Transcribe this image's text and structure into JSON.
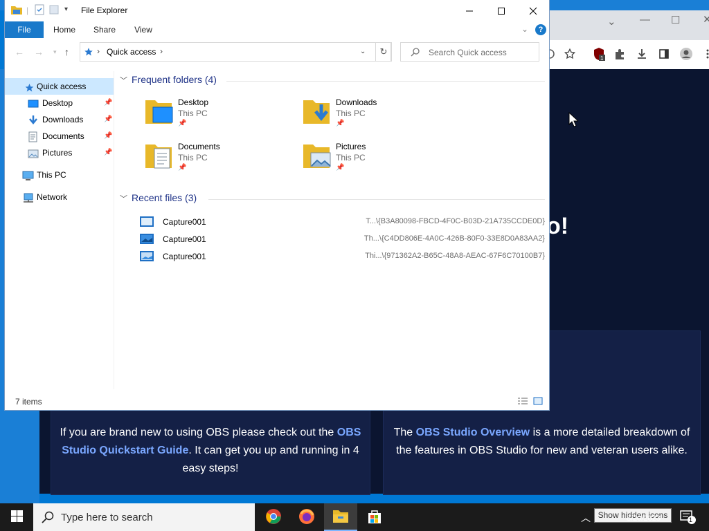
{
  "explorer": {
    "title": "File Explorer",
    "ribbon_tabs": [
      "File",
      "Home",
      "Share",
      "View"
    ],
    "help_label": "?",
    "address": "Quick access",
    "search_placeholder": "Search Quick access",
    "nav": [
      {
        "label": "Quick access",
        "icon": "star-icon",
        "selected": true
      },
      {
        "label": "Desktop",
        "icon": "desktop-icon",
        "pinned": true
      },
      {
        "label": "Downloads",
        "icon": "download-arrow-icon",
        "pinned": true
      },
      {
        "label": "Documents",
        "icon": "document-icon",
        "pinned": true
      },
      {
        "label": "Pictures",
        "icon": "pictures-icon",
        "pinned": true
      },
      {
        "label": "This PC",
        "icon": "computer-icon"
      },
      {
        "label": "Network",
        "icon": "network-icon"
      }
    ],
    "frequent_header": "Frequent folders (4)",
    "frequent": [
      {
        "name": "Desktop",
        "location": "This PC"
      },
      {
        "name": "Downloads",
        "location": "This PC"
      },
      {
        "name": "Documents",
        "location": "This PC"
      },
      {
        "name": "Pictures",
        "location": "This PC"
      }
    ],
    "recent_header": "Recent files (3)",
    "recent": [
      {
        "name": "Capture001",
        "path": "T...\\{B3A80098-FBCD-4F0C-B03D-21A735CCDE0D}"
      },
      {
        "name": "Capture001",
        "path": "Th...\\{C4DD806E-4A0C-426B-80F0-33E8D0A83AA2}"
      },
      {
        "name": "Capture001",
        "path": "Thi...\\{971362A2-B65C-48A8-AEAC-67F6C70100B7}"
      }
    ],
    "status": "7 items"
  },
  "browser_page": {
    "partial_heading": "o!",
    "card_left_pre": "If you are brand new to using OBS please check out the ",
    "card_left_link": "OBS Studio Quickstart Guide",
    "card_left_post": ". It can get you up and running in 4 easy steps!",
    "card_right_pre": "The ",
    "card_right_link": "OBS Studio Overview",
    "card_right_post": " is a more detailed breakdown of the features in OBS Studio for new and veteran users alike."
  },
  "taskbar": {
    "search_placeholder": "Type here to search",
    "tooltip": "Show hidden icons",
    "date": "8/20/2023",
    "notification_count": "1"
  },
  "colors": {
    "accent": "#1979ca",
    "page_bg": "#0b1530",
    "link": "#7aa7ff"
  }
}
